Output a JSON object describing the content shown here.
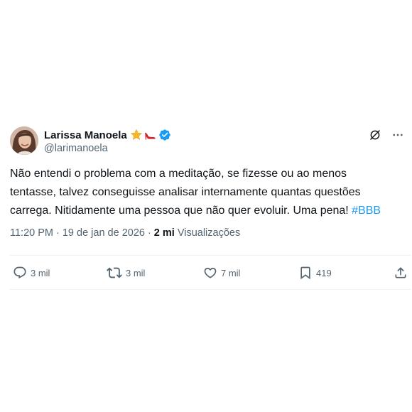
{
  "author": {
    "display_name": "Larissa Manoela",
    "handle": "@larimanoela",
    "emojis": [
      "star-emoji",
      "high-heel-emoji"
    ],
    "verified": true,
    "avatar": "avatar-photo"
  },
  "header_actions": {
    "grok_icon": "grok-icon",
    "more_icon": "more-options-icon"
  },
  "tweet": {
    "lines": [
      "Não entendi o problema com a meditação, se fizesse ou ao menos",
      "tentasse, talvez conseguisse analisar internamente quantas questões",
      "carrega. Nitidamente uma pessoa que não quer evoluir. Uma pena! "
    ],
    "hashtag": "#BBB"
  },
  "meta": {
    "time": "11:20 PM",
    "separator": "·",
    "date": "19 de jan de 2026",
    "views_count": "2 mi",
    "views_label": "Visualizações"
  },
  "stats": {
    "replies": "3 mil",
    "retweets": "3 mil",
    "likes": "7 mil",
    "bookmarks": "419"
  },
  "colors": {
    "text": "#0f1419",
    "secondary": "#536471",
    "accent": "#1d9bf0",
    "divider": "#eff3f4"
  }
}
